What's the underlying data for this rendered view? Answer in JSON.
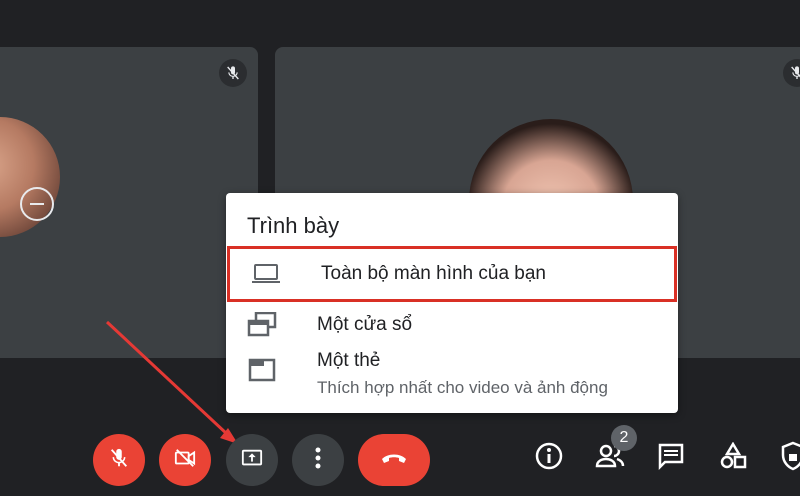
{
  "present_menu": {
    "title": "Trình bày",
    "items": [
      {
        "label": "Toàn bộ màn hình của bạn",
        "icon": "laptop-icon"
      },
      {
        "label": "Một cửa sổ",
        "icon": "window-icon"
      },
      {
        "label": "Một thẻ",
        "sublabel": "Thích hợp nhất cho video và ảnh động",
        "icon": "tab-icon"
      }
    ]
  },
  "participants": {
    "count": "2"
  },
  "colors": {
    "accent_red": "#ea4335",
    "highlight_border": "#d93025",
    "tile_bg": "#3c4043"
  },
  "controls": [
    "mic-off-icon",
    "camera-off-icon",
    "present-screen-icon",
    "more-options-icon",
    "hang-up-icon"
  ],
  "right_controls": [
    "info-icon",
    "people-icon",
    "chat-icon",
    "activities-icon",
    "host-controls-icon"
  ]
}
